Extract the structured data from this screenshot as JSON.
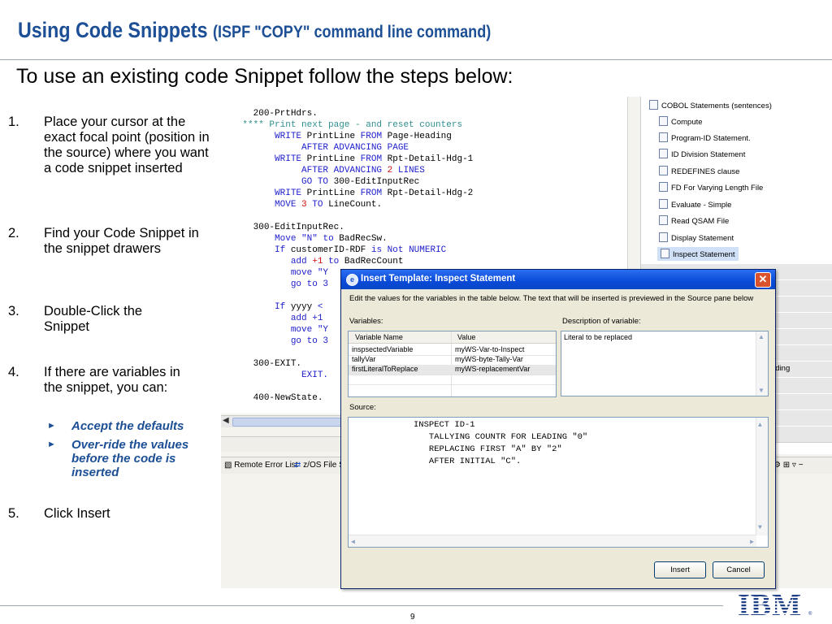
{
  "slide": {
    "title_main": "Using Code Snippets",
    "title_sub": "(ISPF \"COPY\" command line command)",
    "subtitle": "To use an existing code Snippet follow the steps below:",
    "page_number": "9",
    "logo_text": "IBM"
  },
  "steps": [
    {
      "num": "1.",
      "text": "Place your cursor at the exact focal point (position in the source) where you want a code snippet inserted"
    },
    {
      "num": "2.",
      "text": "Find your Code Snippet in the snippet drawers"
    },
    {
      "num": "3.",
      "text": "Double-Click the Snippet"
    },
    {
      "num": "4.",
      "text": "If there are variables in the snippet, you can:"
    },
    {
      "num": "5.",
      "text": "Click Insert"
    }
  ],
  "sub_bullets": [
    "Accept the defaults",
    "Over-ride the values before the code is inserted"
  ],
  "editor": {
    "lines": [
      " 200-PrtHdrs.",
      "**** Print next page - and reset counters",
      "     WRITE PrintLine FROM Page-Heading",
      "          AFTER ADVANCING PAGE",
      "     WRITE PrintLine FROM Rpt-Detail-Hdg-1",
      "          AFTER ADVANCING 2 LINES",
      "          GO TO 300-EditInputRec",
      "     WRITE PrintLine FROM Rpt-Detail-Hdg-2",
      "     MOVE 3 TO LineCount.",
      "",
      " 300-EditInputRec.",
      "     Move \"N\" to BadRecSw.",
      "     If customerID-RDF is Not NUMERIC",
      "        add +1 to BadRecCount",
      "        move \"Y",
      "        go to 3",
      "",
      "     If yyyy <",
      "        add +1",
      "        move \"Y",
      "        go to 3",
      "",
      " 300-EXIT.",
      "     EXIT.",
      "",
      " 400-NewState."
    ],
    "tabs": [
      "Remote Error List",
      "z/OS File S"
    ]
  },
  "snippets": {
    "drawer_title": "COBOL Statements (sentences)",
    "items": [
      "Compute",
      "Program-ID Statement.",
      "ID Division Statement",
      "REDEFINES clause",
      "FD For Varying Length File",
      "Evaluate - Simple",
      "Read QSAM File",
      "Display Statement",
      "Inspect Statement"
    ],
    "partial_label": "nding"
  },
  "dialog": {
    "title": "Insert Template: Inspect Statement",
    "instruction": "Edit the values for the variables in the table below.  The text that will be inserted is previewed in the Source pane below",
    "variables_label": "Variables:",
    "description_label": "Description of variable:",
    "source_label": "Source:",
    "col_name": "Variable Name",
    "col_value": "Value",
    "variables": [
      {
        "name": "inspsectedVariable",
        "value": "myWS-Var-to-Inspect"
      },
      {
        "name": "tallyVar",
        "value": "myWS-byte-Tally-Var"
      },
      {
        "name": "firstLiteralToReplace",
        "value": "myWS-replacementVar"
      }
    ],
    "description": "Literal to be replaced",
    "source_lines": [
      "INSPECT ID-1",
      "   TALLYING COUNTR FOR LEADING \"0\"",
      "   REPLACING FIRST \"A\" BY \"2\"",
      "   AFTER INITIAL \"C\"."
    ],
    "insert_label": "Insert",
    "cancel_label": "Cancel",
    "close_glyph": "✕"
  }
}
